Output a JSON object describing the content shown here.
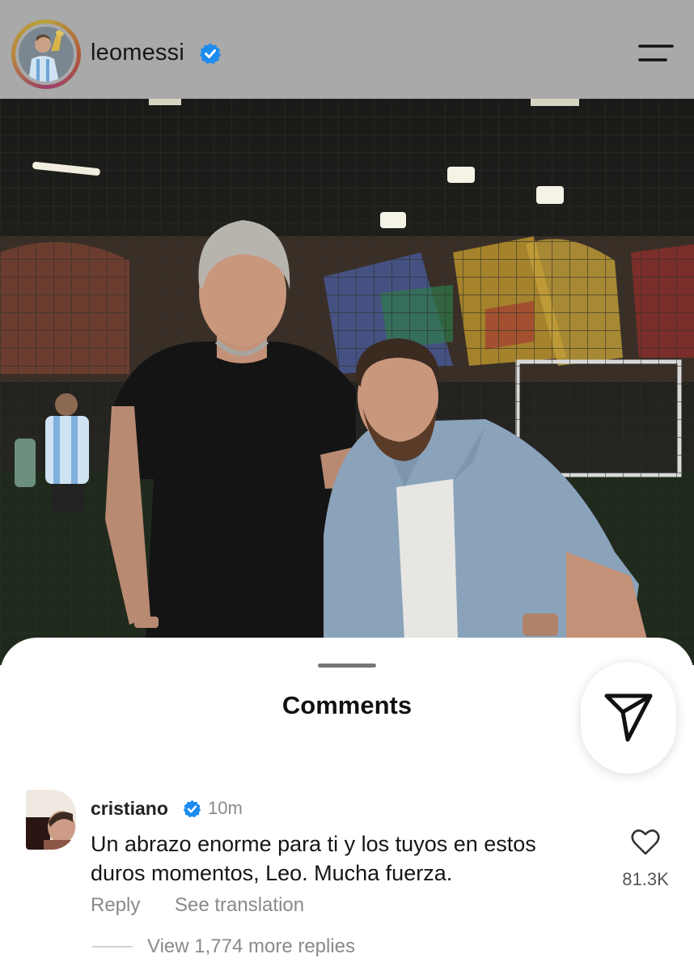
{
  "header": {
    "username": "leomessi",
    "verified": true,
    "avatar_icon": "profile-avatar",
    "menu_icon": "menu-icon"
  },
  "post": {
    "image_icon": "post-photo"
  },
  "comments_sheet": {
    "title": "Comments",
    "share_icon": "send-icon",
    "comments": [
      {
        "username": "cristiano",
        "verified": true,
        "time": "10m",
        "text": "Un abrazo enorme para ti y los tuyos en estos duros momentos, Leo. Mucha fuerza.",
        "reply_label": "Reply",
        "translate_label": "See translation",
        "likes": "81.3K",
        "view_replies_label": "View 1,774 more replies"
      }
    ]
  },
  "colors": {
    "verified_blue": "#1d8cf0",
    "header_dim": "#a9a9a9",
    "secondary_text": "#8a8a8a"
  }
}
